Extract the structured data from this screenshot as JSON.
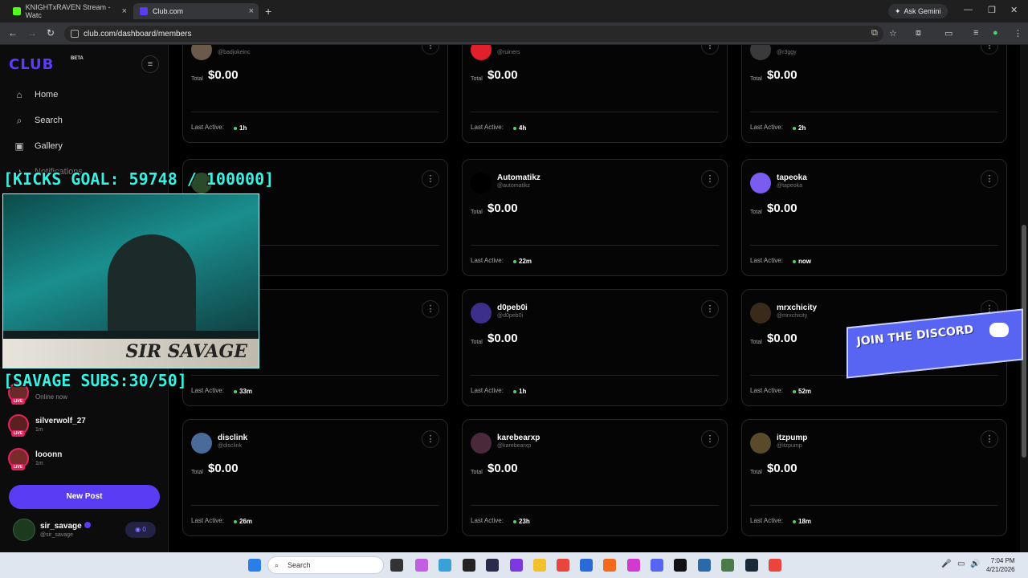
{
  "browser": {
    "tabs": [
      {
        "title": "KNIGHTxRAVEN Stream - Watc",
        "active": false,
        "color": "#53fc18"
      },
      {
        "title": "Club.com",
        "active": true,
        "color": "#5b3cf5"
      }
    ],
    "ask_gemini": "Ask Gemini",
    "url": "club.com/dashboard/members"
  },
  "sidebar": {
    "logo": "CLUB",
    "logo_badge": "BETA",
    "nav": [
      {
        "label": "Home",
        "icon": "home-icon"
      },
      {
        "label": "Search",
        "icon": "search-icon"
      },
      {
        "label": "Gallery",
        "icon": "gallery-icon"
      },
      {
        "label": "Notifications",
        "icon": "bell-icon"
      }
    ],
    "live_users": [
      {
        "name": "Online now",
        "sub": "",
        "badge": "LIVE"
      },
      {
        "name": "silverwolf_27",
        "sub": "1m",
        "badge": "LIVE"
      },
      {
        "name": "looonn",
        "sub": "1m",
        "badge": "LIVE"
      }
    ],
    "new_post": "New Post",
    "me": {
      "name": "sir_savage",
      "handle": "@sir_savage",
      "pill": "0"
    }
  },
  "cards": [
    {
      "name": "",
      "handle": "@badjokeinc",
      "total_label": "Total",
      "total": "$0.00",
      "last_active_label": "Last Active:",
      "last_active": "1h",
      "avatar": "#6b5a4a"
    },
    {
      "name": "",
      "handle": "@ruiners",
      "total_label": "Total",
      "total": "$0.00",
      "last_active_label": "Last Active:",
      "last_active": "4h",
      "avatar": "#e0202a"
    },
    {
      "name": "",
      "handle": "@r3ggy",
      "total_label": "Total",
      "total": "$0.00",
      "last_active_label": "Last Active:",
      "last_active": "2h",
      "avatar": "#3a3a3a"
    },
    {
      "name": "",
      "handle": "",
      "total_label": "Total",
      "total": "$0.00",
      "last_active_label": "Last Active:",
      "last_active": "",
      "avatar": "#2a4a2a"
    },
    {
      "name": "Automatikz",
      "handle": "@automatikz",
      "total_label": "Total",
      "total": "$0.00",
      "last_active_label": "Last Active:",
      "last_active": "22m",
      "avatar": "#000000"
    },
    {
      "name": "tapeoka",
      "handle": "@tapeoka",
      "total_label": "Total",
      "total": "$0.00",
      "last_active_label": "Last Active:",
      "last_active": "now",
      "avatar": "#7a5cf0"
    },
    {
      "name": "",
      "handle": "",
      "total_label": "Total",
      "total": "$0.00",
      "last_active_label": "Last Active:",
      "last_active": "33m",
      "avatar": "#333333"
    },
    {
      "name": "d0peb0i",
      "handle": "@d0peb0i",
      "total_label": "Total",
      "total": "$0.00",
      "last_active_label": "Last Active:",
      "last_active": "1h",
      "avatar": "#3b2f8a"
    },
    {
      "name": "mrxchicity",
      "handle": "@mrxchicity",
      "total_label": "Total",
      "total": "$0.00",
      "last_active_label": "Last Active:",
      "last_active": "52m",
      "avatar": "#3a2a1a"
    },
    {
      "name": "disclink",
      "handle": "@disclink",
      "total_label": "Total",
      "total": "$0.00",
      "last_active_label": "Last Active:",
      "last_active": "26m",
      "avatar": "#4a6a9a"
    },
    {
      "name": "karebearxp",
      "handle": "@karebearxp",
      "total_label": "Total",
      "total": "$0.00",
      "last_active_label": "Last Active:",
      "last_active": "23h",
      "avatar": "#4a2a3a"
    },
    {
      "name": "itzpump",
      "handle": "@itzpump",
      "total_label": "Total",
      "total": "$0.00",
      "last_active_label": "Last Active:",
      "last_active": "18m",
      "avatar": "#5a4a2a"
    }
  ],
  "overlay": {
    "kicks_goal": "[KICKS GOAL: 59748 / 100000]",
    "savage_subs": "[SAVAGE SUBS:30/50]",
    "banner": "SIR SAVAGE",
    "discord": "JOIN THE DISCORD"
  },
  "taskbar": {
    "search": "Search",
    "time": "7:04 PM",
    "date": "4/21/2026"
  }
}
